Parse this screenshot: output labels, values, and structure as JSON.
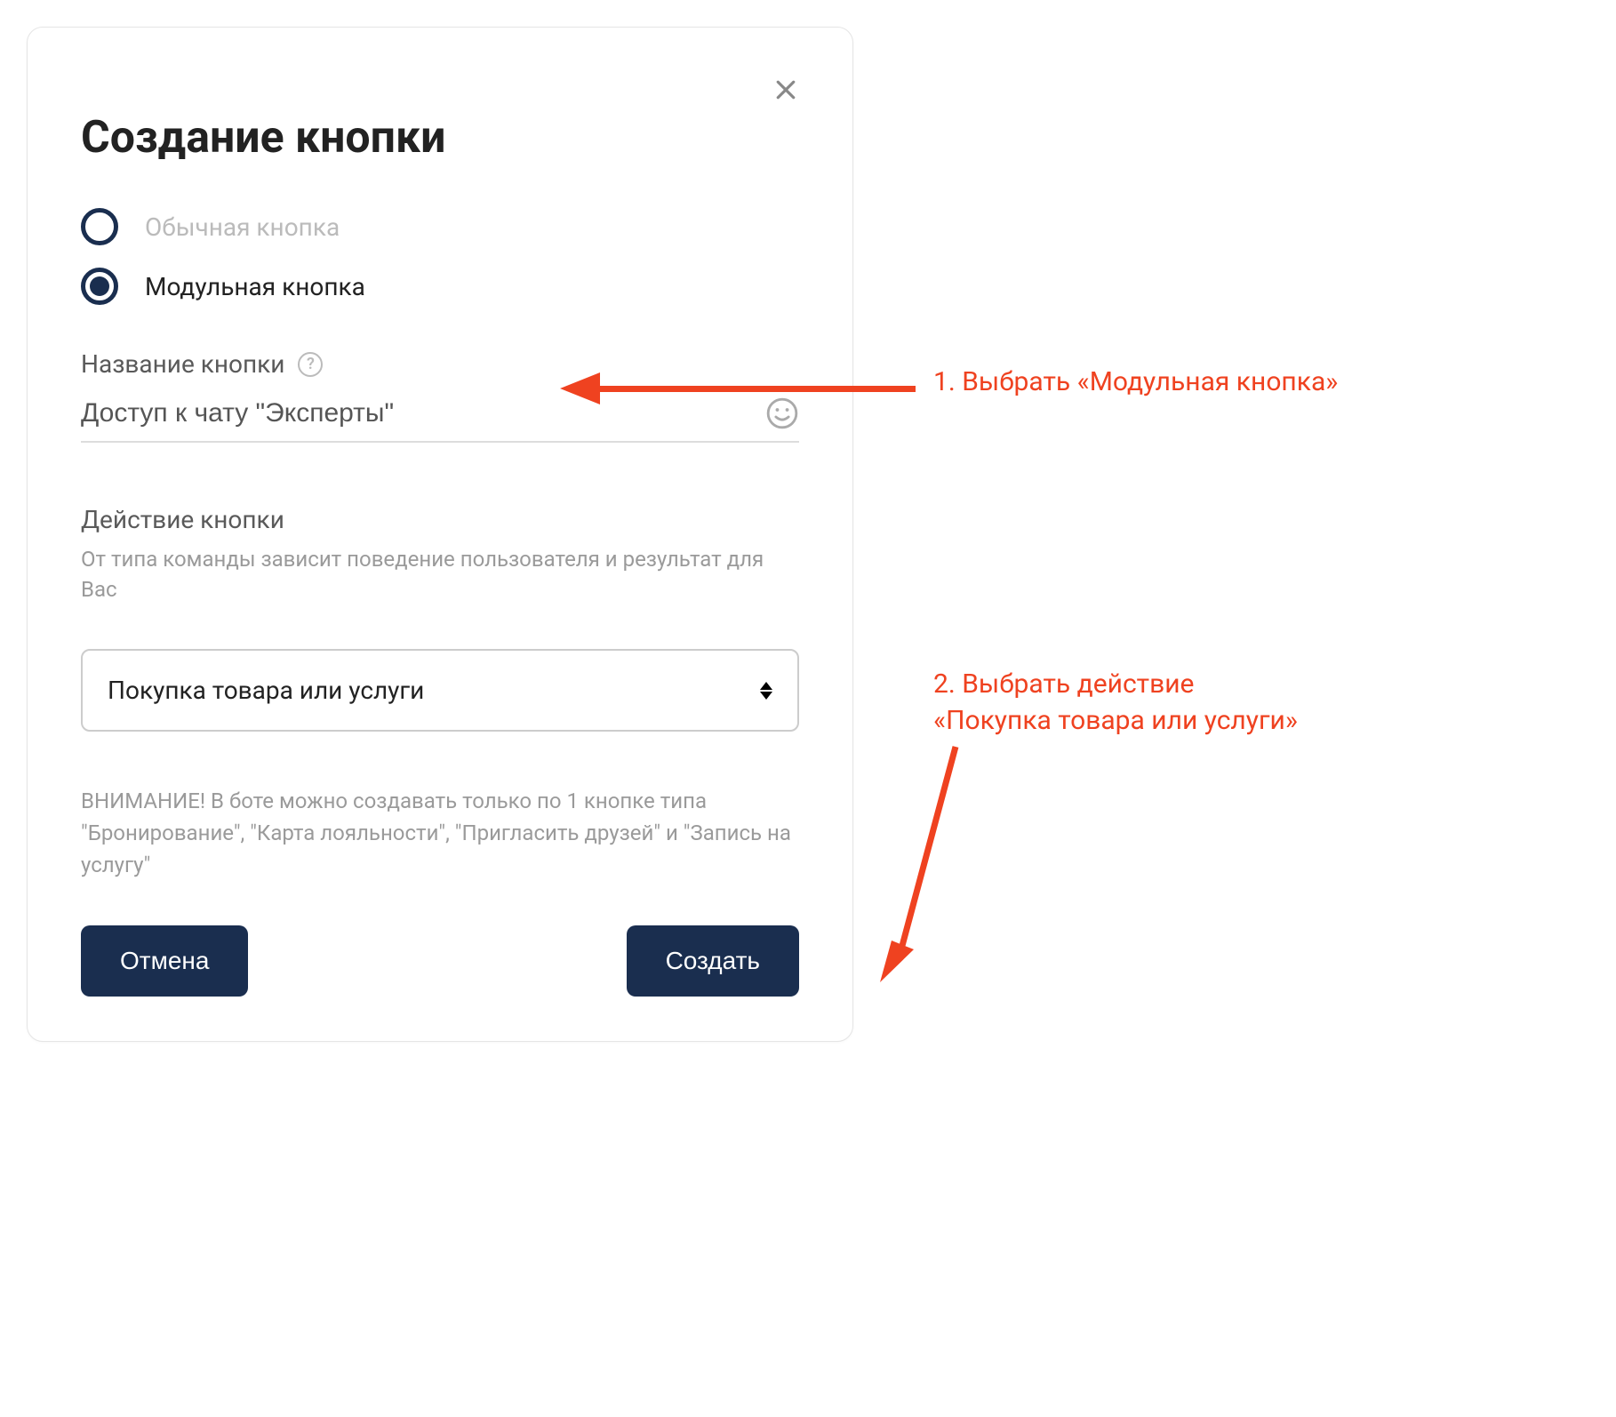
{
  "dialog": {
    "title": "Создание кнопки",
    "radio_options": {
      "regular": "Обычная кнопка",
      "modular": "Модульная кнопка"
    },
    "name_field": {
      "label": "Название кнопки",
      "value": "Доступ к чату \"Эксперты\""
    },
    "action_field": {
      "label": "Действие кнопки",
      "description": "От типа команды зависит поведение пользователя и результат для Вас",
      "selected_value": "Покупка товара или услуги"
    },
    "warning": "ВНИМАНИЕ! В боте можно создавать только по 1 кнопке типа \"Бронирование\", \"Карта лояльности\", \"Пригласить друзей\" и \"Запись на услугу\"",
    "buttons": {
      "cancel": "Отмена",
      "create": "Создать"
    }
  },
  "annotations": {
    "step1": "1. Выбрать «Модульная кнопка»",
    "step2_line1": "2. Выбрать действие",
    "step2_line2": "«Покупка товара или услуги»"
  },
  "colors": {
    "accent": "#1a2e4f",
    "annotation": "#ef4220"
  }
}
